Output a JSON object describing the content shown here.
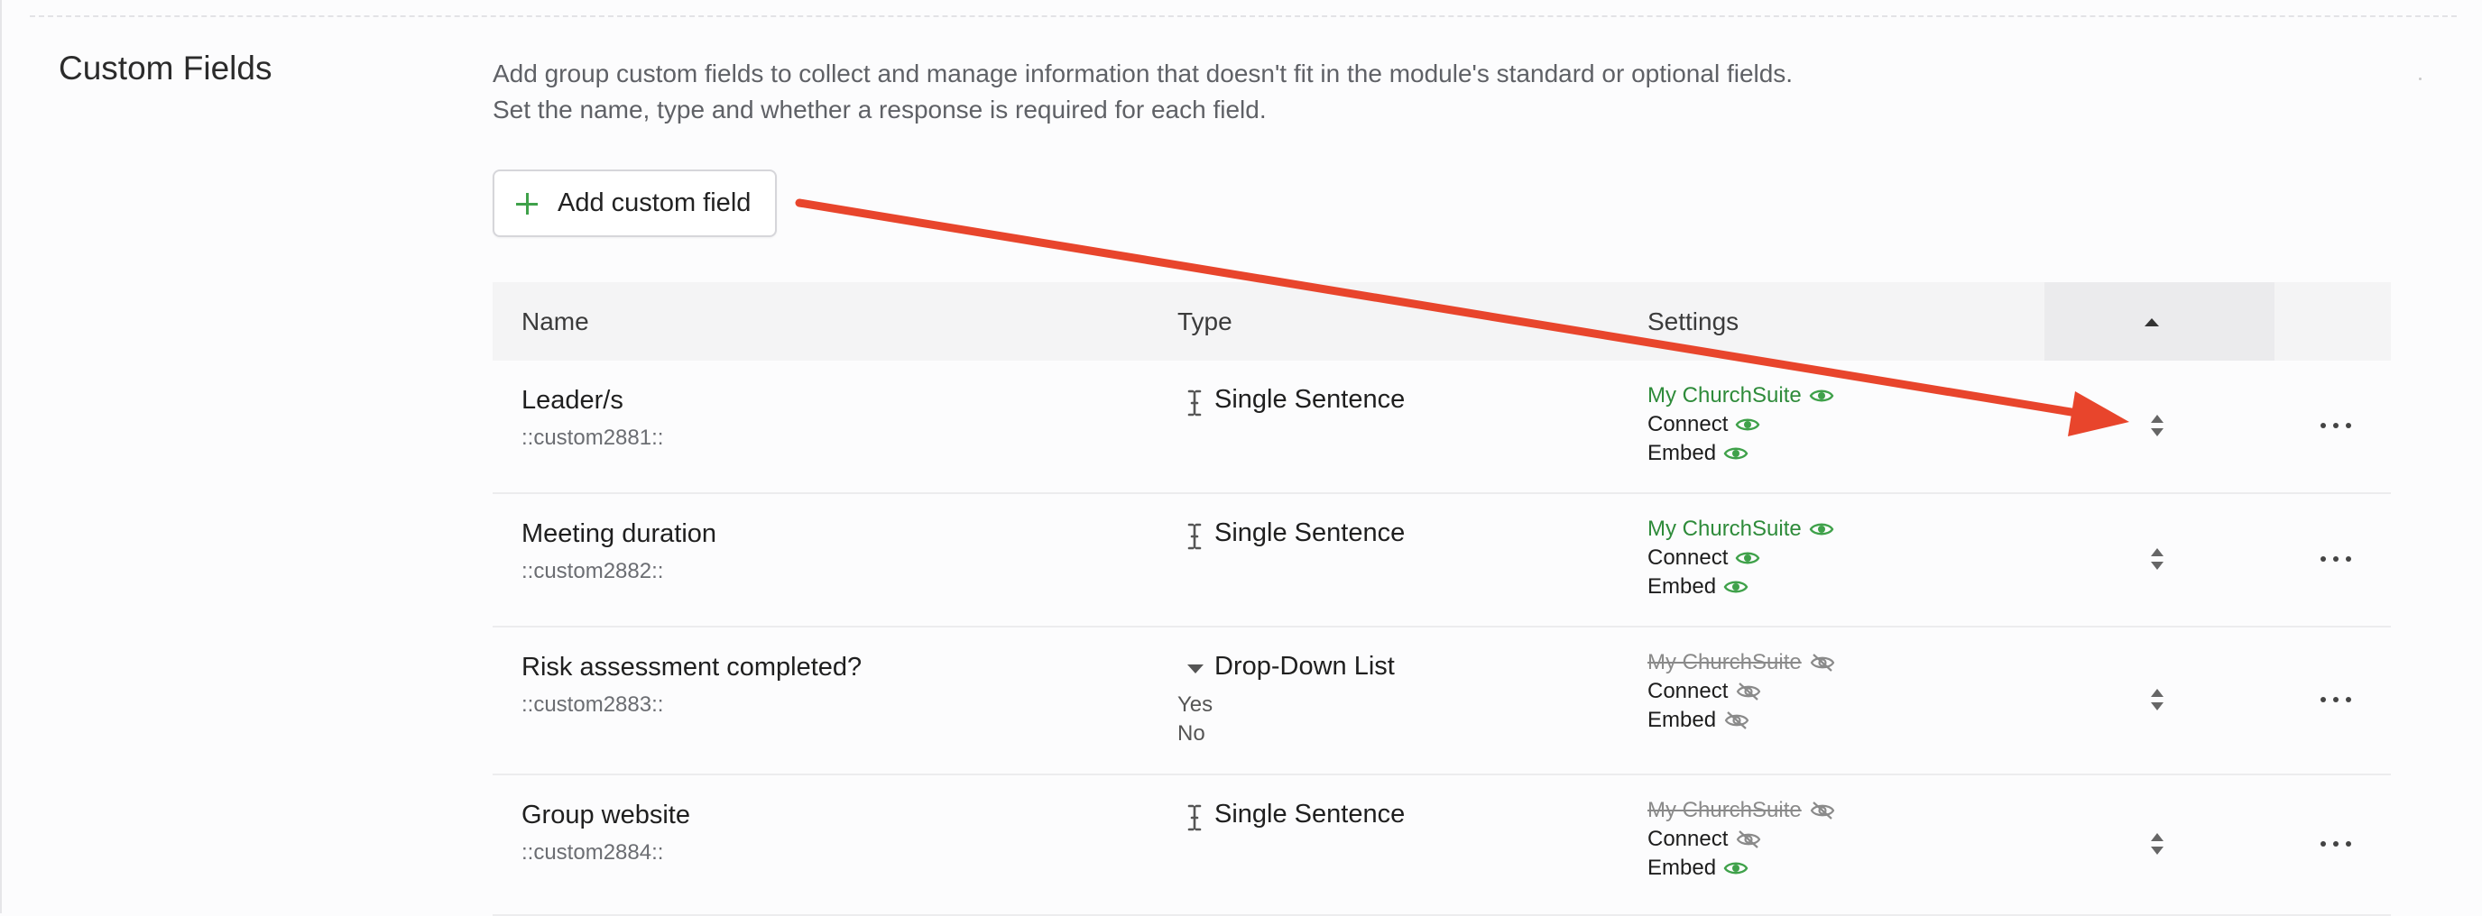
{
  "section": {
    "title": "Custom Fields",
    "description": "Add group custom fields to collect and manage information that doesn't fit in the module's standard or optional fields. Set the name, type and whether a response is required for each field."
  },
  "add_button": {
    "label": "Add custom field",
    "icon": "plus-icon"
  },
  "table": {
    "headers": {
      "name": "Name",
      "type": "Type",
      "settings": "Settings"
    },
    "rows": [
      {
        "name": "Leader/s",
        "code": "::custom2881::",
        "type": "Single Sentence",
        "type_icon": "text-cursor-icon",
        "options": [],
        "settings": [
          {
            "label": "My ChurchSuite",
            "visible": true
          },
          {
            "label": "Connect",
            "visible": true
          },
          {
            "label": "Embed",
            "visible": true
          }
        ]
      },
      {
        "name": "Meeting duration",
        "code": "::custom2882::",
        "type": "Single Sentence",
        "type_icon": "text-cursor-icon",
        "options": [],
        "settings": [
          {
            "label": "My ChurchSuite",
            "visible": true
          },
          {
            "label": "Connect",
            "visible": true
          },
          {
            "label": "Embed",
            "visible": true
          }
        ]
      },
      {
        "name": "Risk assessment completed?",
        "code": "::custom2883::",
        "type": "Drop-Down List",
        "type_icon": "caret-down-icon",
        "options": [
          "Yes",
          "No"
        ],
        "settings": [
          {
            "label": "My ChurchSuite",
            "visible": false
          },
          {
            "label": "Connect",
            "visible": false
          },
          {
            "label": "Embed",
            "visible": false
          }
        ]
      },
      {
        "name": "Group website",
        "code": "::custom2884::",
        "type": "Single Sentence",
        "type_icon": "text-cursor-icon",
        "options": [],
        "settings": [
          {
            "label": "My ChurchSuite",
            "visible": false
          },
          {
            "label": "Connect",
            "visible": false
          },
          {
            "label": "Embed",
            "visible": true
          }
        ]
      }
    ]
  },
  "colors": {
    "visible_green": "#3fa14a",
    "hidden_grey": "#8a8a8a",
    "annotation_arrow": "#e8452c"
  }
}
